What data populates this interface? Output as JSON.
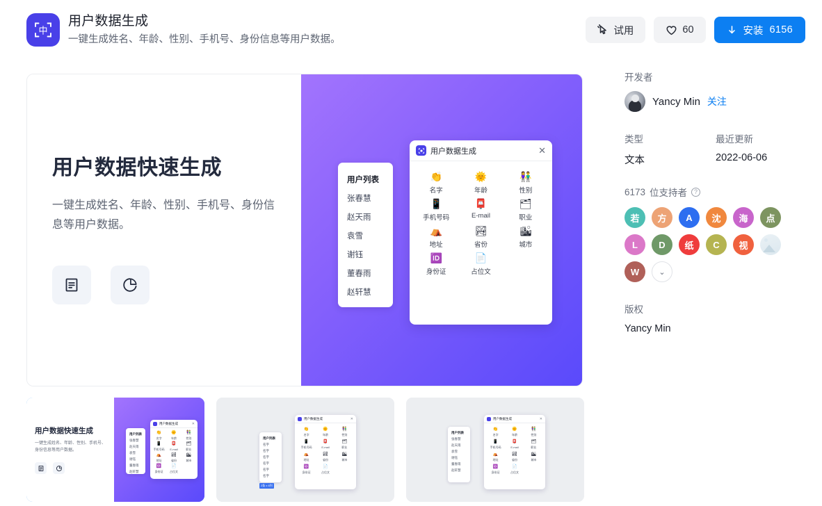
{
  "header": {
    "icon_name": "scan-cn-icon",
    "icon_glyph": "中",
    "title": "用户数据生成",
    "subtitle": "一键生成姓名、年龄、性别、手机号、身份信息等用户数据。",
    "accent_purple": "#4940e8",
    "try_label": "试用",
    "like_count": "60",
    "install_label": "安装",
    "install_count": "6156",
    "install_color": "#0c7ff2"
  },
  "hero": {
    "title": "用户数据快速生成",
    "paragraph": "一键生成姓名、年龄、性别、手机号、身份信息等用户数据。",
    "buttons": [
      {
        "name": "document-icon",
        "label": "文档"
      },
      {
        "name": "pie-chart-icon",
        "label": "图表"
      }
    ],
    "gradient_from": "#a274fd",
    "gradient_to": "#5a4afb",
    "user_list": {
      "header": "用户列表",
      "names": [
        "张春慧",
        "赵天雨",
        "袁雪",
        "谢钰",
        "董春雨",
        "赵轩慧"
      ]
    },
    "dialog": {
      "title": "用户数据生成",
      "close": "✕",
      "items": [
        {
          "emoji": "👏",
          "label": "名字"
        },
        {
          "emoji": "🌞",
          "label": "年龄"
        },
        {
          "emoji": "👫",
          "label": "性别"
        },
        {
          "emoji": "📱",
          "label": "手机号码"
        },
        {
          "emoji": "📮",
          "label": "E-mail"
        },
        {
          "emoji": "🗂",
          "label": "职业"
        },
        {
          "emoji": "⛺",
          "label": "地址"
        },
        {
          "emoji": "🏞",
          "label": "省份"
        },
        {
          "emoji": "🏙",
          "label": "城市"
        },
        {
          "emoji": "🆔",
          "label": "身份证"
        },
        {
          "emoji": "📄",
          "label": "占位文"
        }
      ]
    }
  },
  "thumbnails": [
    {
      "name": "thumbnail-1",
      "selected": true
    },
    {
      "name": "thumbnail-2",
      "selected": false,
      "chip": "2条 x 6列"
    },
    {
      "name": "thumbnail-3",
      "selected": false
    }
  ],
  "thumb_mini": {
    "title": "用户数据快速生成",
    "paragraph": "一键生成姓名、年龄、性别、手机号、身份信息等用户数据。",
    "list_header": "用户列表",
    "list_names": [
      "张春慧",
      "赵天雨",
      "袁雪",
      "谢钰",
      "董春雨",
      "赵轩慧"
    ],
    "list_names_generic": [
      "名字",
      "名字",
      "名字",
      "名字",
      "名字",
      "名字"
    ],
    "dialog_title": "用户数据生成"
  },
  "sidebar": {
    "developer_label": "开发者",
    "developer_name": "Yancy Min",
    "follow_label": "关注",
    "type_label": "类型",
    "type_value": "文本",
    "updated_label": "最近更新",
    "updated_value": "2022-06-06",
    "supporters_count": "6173",
    "supporters_label": "位支持者",
    "help_icon": "?",
    "supporters": [
      {
        "text": "若",
        "color": "#4dbfb4"
      },
      {
        "text": "方",
        "color": "#eda375"
      },
      {
        "text": "A",
        "color": "#2d6ef0"
      },
      {
        "text": "沈",
        "color": "#f0883e"
      },
      {
        "text": "海",
        "color": "#c865cb"
      },
      {
        "text": "点",
        "color": "#7d9460"
      },
      {
        "text": "L",
        "color": "#db78c8"
      },
      {
        "text": "D",
        "color": "#6f9968"
      },
      {
        "text": "纸",
        "color": "#ef3c3c"
      },
      {
        "text": "C",
        "color": "#b5b451"
      },
      {
        "text": "视",
        "color": "#f0613e"
      },
      {
        "text": "",
        "color": "#e3edf3",
        "photo": true
      },
      {
        "text": "W",
        "color": "#b06059"
      }
    ],
    "expand_icon": "⌄",
    "copyright_label": "版权",
    "copyright_value": "Yancy Min"
  }
}
